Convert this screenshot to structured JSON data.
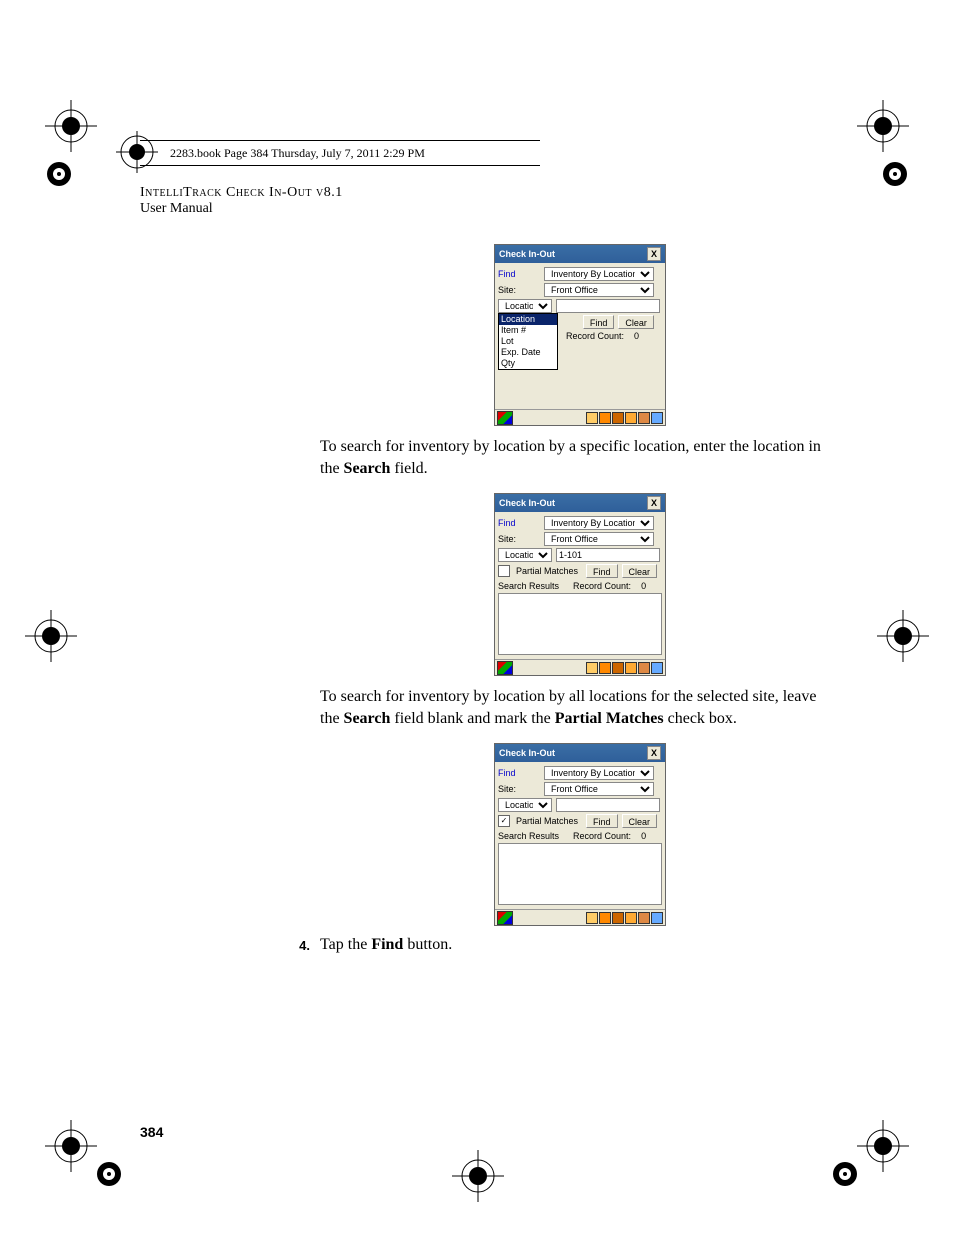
{
  "header_strip": "2283.book  Page 384  Thursday, July 7, 2011  2:29 PM",
  "running_head_title": "IntelliTrack Check In-Out v8.1",
  "running_head_sub": "User Manual",
  "page_number": "384",
  "para1_a": "To search for inventory by location by a specific location, enter the location in the ",
  "para1_b": "Search",
  "para1_c": " field.",
  "para2_a": "To search for inventory by location by all locations for the selected site, leave the ",
  "para2_b": "Search",
  "para2_c": " field blank and mark the ",
  "para2_d": "Partial Matches",
  "para2_e": " check box.",
  "step4_num": "4.",
  "step4_a": "Tap the ",
  "step4_b": "Find",
  "step4_c": " button.",
  "dev": {
    "title": "Check In-Out",
    "close": "X",
    "find_label": "Find",
    "find_value": "Inventory By Location",
    "site_label": "Site:",
    "site_value": "Front Office",
    "loc_field_label": "Location",
    "dropdown_options": [
      "Location",
      "Item #",
      "Lot",
      "Exp. Date",
      "Qty"
    ],
    "partial_matches_label": "Partial Matches",
    "find_btn": "Find",
    "clear_btn": "Clear",
    "search_results_label": "Search Results",
    "record_count_label": "Record Count:",
    "record_count_value": "0",
    "search_value_2": "1-101",
    "pm_checked_1": false,
    "pm_checked_3": true
  }
}
